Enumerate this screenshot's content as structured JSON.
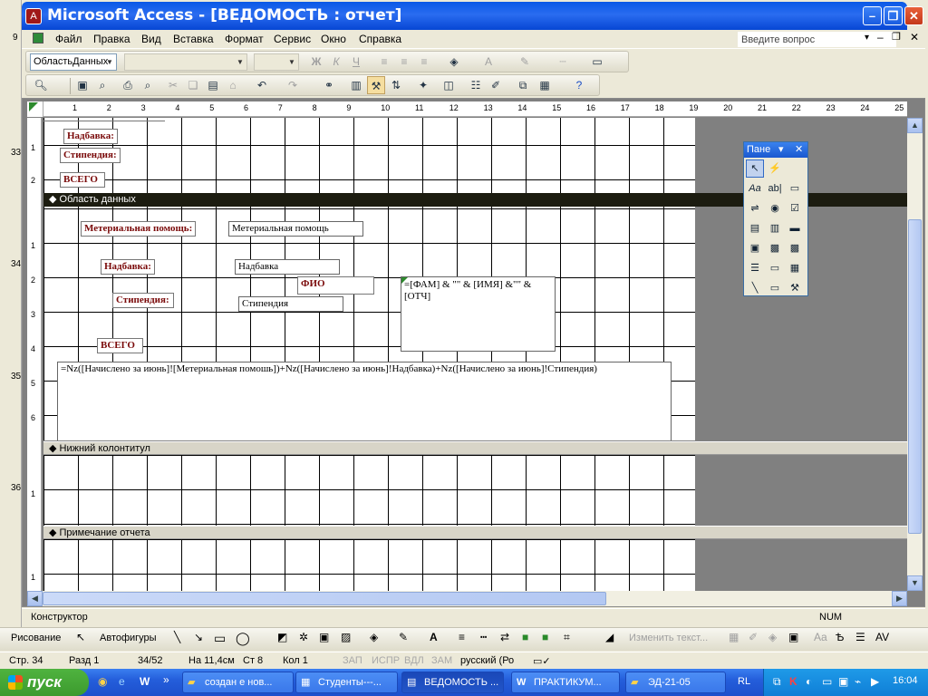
{
  "window": {
    "title": "Microsoft Access - [ВЕДОМОСТЬ : отчет]",
    "app_icon": "access-key-icon"
  },
  "menu": {
    "items": [
      "Файл",
      "Правка",
      "Вид",
      "Вставка",
      "Формат",
      "Сервис",
      "Окно",
      "Справка"
    ],
    "ask_placeholder": "Введите вопрос"
  },
  "format_toolbar": {
    "object_combo": "ОбластьДанных",
    "font_combo": "",
    "size_combo": ""
  },
  "ruler": {
    "ticks": [
      "1",
      "2",
      "3",
      "4",
      "5",
      "6",
      "7",
      "8",
      "9",
      "10",
      "11",
      "12",
      "13",
      "14",
      "15",
      "16",
      "17",
      "18",
      "19",
      "20",
      "21",
      "22",
      "23",
      "24",
      "25"
    ]
  },
  "left_margin_numbers": [
    "9",
    "1",
    "2",
    "3",
    "33",
    "34",
    "35",
    "36"
  ],
  "vruler": {
    "numbers_top": [
      "1",
      "2"
    ],
    "numbers_data": [
      "1",
      "2",
      "3",
      "4",
      "5",
      "6"
    ],
    "numbers_footer": [
      "1"
    ],
    "numbers_note": [
      "1"
    ]
  },
  "report": {
    "header_labels": {
      "nadbavka": "Надбавка:",
      "stipendia": "Стипендия:",
      "vsego": "ВСЕГО"
    },
    "sections": {
      "data": "Область данных",
      "page_footer": "Нижний колонтитул",
      "report_footer": "Примечание отчета"
    },
    "data_controls": {
      "mat_label": "Метериальная помощь:",
      "mat_field": "Метериальная помощь",
      "nad_label": "Надбавка:",
      "nad_field": "Надбавка",
      "fio_label": "ФИО",
      "fio_field": "=[ФАМ] & \"\" & [ИМЯ] &\"\" & [ОТЧ]",
      "stip_label": "Стипендия:",
      "stip_field": "Стипендия",
      "vsego_label": "ВСЕГО",
      "formula": "=Nz([Начислено за июнь]![Метериальная помошь])+Nz([Начислено за июнь]!Надбавка)+Nz([Начислено за июнь]!Стипендия)"
    }
  },
  "toolbox": {
    "title": "Пане"
  },
  "status": {
    "mode": "Конструктор",
    "num": "NUM"
  },
  "drawing_bar": {
    "draw": "Рисование",
    "autoshapes": "Автофигуры",
    "edit_text": "Изменить текст..."
  },
  "word_status": {
    "page": "Стр. 34",
    "section": "Разд 1",
    "pages": "34/52",
    "at": "На 11,4см",
    "line": "Ст 8",
    "col": "Кол 1",
    "rec": "ЗАП",
    "trk": "ИСПР",
    "ext": "ВДЛ",
    "ovr": "ЗАМ",
    "lang": "русский (Ро"
  },
  "taskbar": {
    "start": "пуск",
    "tasks": [
      "создан е нов...",
      "Студенты---...",
      "ВЕДОМОСТЬ ...",
      "ПРАКТИКУМ...",
      "ЭД-21-05"
    ],
    "lang": "RL",
    "clock": "16:04"
  }
}
